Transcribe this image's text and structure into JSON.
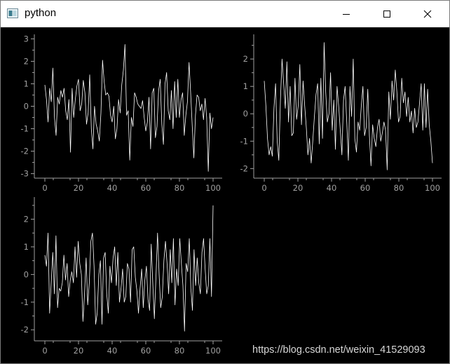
{
  "window": {
    "title": "python",
    "controls": {
      "minimize": "minimize",
      "maximize": "maximize",
      "close": "close"
    }
  },
  "watermark": "https://blog.csdn.net/weixin_41529093",
  "colors": {
    "background": "#000000",
    "axis": "#a0a0a0",
    "series": "#ffffff",
    "titlebar": "#ffffff"
  },
  "chart_data": [
    {
      "type": "line",
      "xlim": [
        0,
        100
      ],
      "ylim": [
        -3.2,
        3.2
      ],
      "xticks": [
        0,
        20,
        40,
        60,
        80,
        100
      ],
      "yticks": [
        -3,
        -2,
        -1,
        0,
        1,
        2,
        3
      ],
      "series": [
        {
          "values": [
            0.95,
            0.3,
            -0.7,
            0.8,
            0.2,
            1.7,
            -0.5,
            -1.3,
            0.4,
            0.1,
            0.7,
            0.4,
            0.8,
            -0.2,
            -0.6,
            0.3,
            -2.05,
            0.8,
            -0.5,
            0.3,
            0.9,
            1.2,
            -0.2,
            0.1,
            1.15,
            0.6,
            -0.8,
            -0.3,
            1.4,
            -1.0,
            -1.9,
            0.0,
            -0.8,
            -1.1,
            -1.55,
            -0.3,
            2.05,
            1.1,
            0.5,
            0.6,
            0.45,
            -0.4,
            -0.7,
            0.0,
            -1.45,
            -1.0,
            0.3,
            -0.3,
            0.95,
            1.6,
            2.75,
            -0.4,
            -0.2,
            -2.4,
            -0.5,
            -0.9,
            0.6,
            0.4,
            0.1,
            0.0,
            -0.1,
            0.25,
            -0.5,
            -1.1,
            -0.7,
            0.4,
            -1.9,
            0.6,
            0.8,
            -1.4,
            -0.9,
            0.7,
            1.2,
            -0.8,
            -1.7,
            1.0,
            1.5,
            -0.2,
            -0.6,
            0.7,
            -1.0,
            1.1,
            -0.5,
            1.2,
            -0.5,
            0.3,
            0.6,
            -1.3,
            -0.4,
            0.2,
            1.95,
            0.6,
            -0.9,
            -2.3,
            -0.4,
            0.5,
            0.4,
            -0.2,
            0.1,
            -0.6,
            0.35,
            -0.5,
            -2.9,
            -0.3,
            -1.0,
            -0.5
          ]
        }
      ]
    },
    {
      "type": "line",
      "xlim": [
        0,
        100
      ],
      "ylim": [
        -2.35,
        2.9
      ],
      "xticks": [
        0,
        20,
        40,
        60,
        80,
        100
      ],
      "yticks": [
        -2,
        -1,
        0,
        1,
        2
      ],
      "series": [
        {
          "values": [
            1.2,
            0.3,
            -0.9,
            -1.5,
            -1.2,
            -1.55,
            0.2,
            1.1,
            -1.0,
            -1.7,
            0.5,
            2.0,
            1.1,
            0.2,
            1.9,
            -0.3,
            1.0,
            -0.8,
            -0.7,
            1.3,
            -0.2,
            0.3,
            1.8,
            -0.4,
            1.2,
            0.3,
            -0.5,
            -1.5,
            -0.9,
            -1.8,
            -1.0,
            -0.1,
            0.7,
            1.1,
            -1.1,
            1.3,
            -0.9,
            2.6,
            0.8,
            -0.3,
            0.0,
            1.5,
            -0.6,
            0.5,
            -1.3,
            1.0,
            0.3,
            -0.6,
            -1.5,
            0.5,
            1.0,
            -0.3,
            -1.7,
            1.0,
            -0.1,
            2.0,
            -0.9,
            -1.4,
            -0.3,
            -0.6,
            0.3,
            1.0,
            -0.8,
            -0.5,
            0.9,
            -0.8,
            -1.9,
            -0.4,
            -0.9,
            -1.2,
            -0.5,
            -0.2,
            -1.0,
            -0.7,
            -0.3,
            -0.6,
            -2.05,
            0.8,
            -0.2,
            1.2,
            0.5,
            1.6,
            0.8,
            -0.3,
            -0.1,
            1.3,
            0.4,
            0.8,
            -0.1,
            0.6,
            -0.3,
            0.1,
            -0.7,
            0.2,
            -0.5,
            -0.3,
            0.4,
            1.1,
            -0.6,
            1.1,
            -0.5,
            0.9,
            -0.4,
            -1.0,
            -1.8
          ]
        }
      ]
    },
    {
      "type": "line",
      "xlim": [
        0,
        100
      ],
      "ylim": [
        -2.4,
        2.8
      ],
      "xticks": [
        0,
        20,
        40,
        60,
        80,
        100
      ],
      "yticks": [
        -2,
        -1,
        0,
        1,
        2
      ],
      "series": [
        {
          "values": [
            0.7,
            0.3,
            1.5,
            -1.4,
            -0.3,
            0.8,
            -0.7,
            1.4,
            -1.2,
            -0.5,
            -0.6,
            -0.3,
            0.7,
            -0.2,
            0.4,
            -0.8,
            -0.2,
            0.1,
            -0.3,
            1.0,
            -0.1,
            1.2,
            0.4,
            0.0,
            -1.7,
            -0.7,
            0.6,
            -1.1,
            -0.3,
            1.2,
            1.5,
            0.3,
            -1.8,
            -1.4,
            0.0,
            0.5,
            -1.8,
            0.6,
            0.8,
            -0.7,
            -1.4,
            0.3,
            -0.3,
            0.6,
            1.0,
            -0.4,
            0.8,
            -1.0,
            -0.5,
            0.2,
            -1.0,
            -0.8,
            0.4,
            0.2,
            -1.0,
            0.9,
            1.0,
            -0.1,
            -0.6,
            -1.4,
            -0.5,
            0.2,
            -1.2,
            -0.2,
            0.3,
            -0.9,
            -1.3,
            1.1,
            -0.3,
            -1.6,
            -0.1,
            1.5,
            0.0,
            -1.2,
            -0.8,
            0.5,
            1.2,
            0.4,
            -0.7,
            0.9,
            -0.3,
            1.3,
            -1.1,
            0.2,
            -0.4,
            1.3,
            0.4,
            -0.4,
            -2.05,
            0.4,
            0.1,
            1.3,
            -0.5,
            -1.3,
            0.9,
            -0.4,
            0.6,
            -0.3,
            -0.7,
            0.8,
            1.3,
            0.2,
            -0.7,
            -0.4,
            1.3,
            -0.8,
            2.5
          ]
        }
      ]
    }
  ]
}
